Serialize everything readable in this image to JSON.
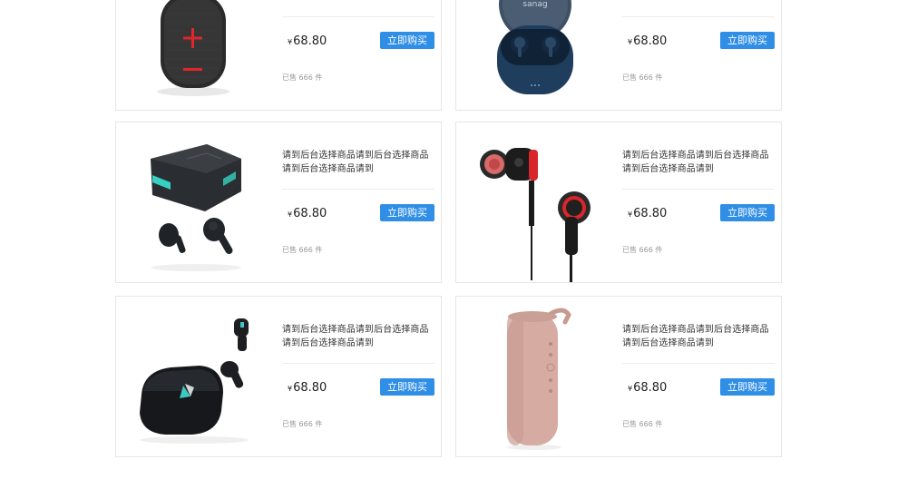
{
  "products": [
    {
      "title": "",
      "currency": "¥",
      "price": "68.80",
      "buy_label": "立即购买",
      "sold": "已售 666 件",
      "image": "red-black-speaker"
    },
    {
      "title": "",
      "currency": "¥",
      "price": "68.80",
      "buy_label": "立即购买",
      "sold": "已售 666 件",
      "image": "navy-earbuds-case"
    },
    {
      "title": "请到后台选择商品请到后台选择商品请到后台选择商品请到",
      "currency": "¥",
      "price": "68.80",
      "buy_label": "立即购买",
      "sold": "已售 666 件",
      "image": "gaming-earbuds"
    },
    {
      "title": "请到后台选择商品请到后台选择商品请到后台选择商品请到",
      "currency": "¥",
      "price": "68.80",
      "buy_label": "立即购买",
      "sold": "已售 666 件",
      "image": "red-wired-earphones"
    },
    {
      "title": "请到后台选择商品请到后台选择商品请到后台选择商品请到",
      "currency": "¥",
      "price": "68.80",
      "buy_label": "立即购买",
      "sold": "已售 666 件",
      "image": "black-earbuds-case"
    },
    {
      "title": "请到后台选择商品请到后台选择商品请到后台选择商品请到",
      "currency": "¥",
      "price": "68.80",
      "buy_label": "立即购买",
      "sold": "已售 666 件",
      "image": "pink-cylinder-speaker"
    }
  ],
  "brand_text": "sanag",
  "colors": {
    "accent": "#2f8ee5",
    "border": "#e6e6e6"
  }
}
